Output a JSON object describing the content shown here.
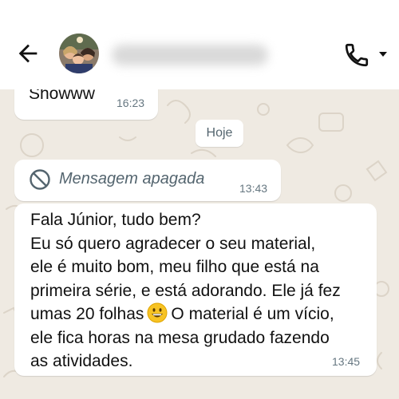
{
  "header": {
    "back_icon": "arrow-left-icon",
    "call_icon": "phone-icon",
    "menu_icon": "caret-down-icon"
  },
  "messages": [
    {
      "text": "Showww",
      "time": "16:23"
    },
    {
      "deleted_label": "Mensagem apagada",
      "icon": "ban-icon",
      "time": "13:43"
    },
    {
      "lines": [
        "Fala Júnior, tudo bem?",
        "Eu só quero agradecer o seu material,",
        "ele é muito bom, meu filho que está na",
        "primeira série, e está adorando. Ele já fez"
      ],
      "line5_before": "umas 20 folhas",
      "emoji": "grinning-face-emoji",
      "line5_after": "O material é um vício,",
      "lines_end": [
        "ele fica horas na mesa grudado fazendo",
        "as atividades."
      ],
      "time": "13:45"
    }
  ],
  "date_chip": "Hoje",
  "colors": {
    "wallpaper": "#efeae2",
    "bubble": "#ffffff",
    "time": "#667781",
    "emoji": "#f7c324"
  }
}
